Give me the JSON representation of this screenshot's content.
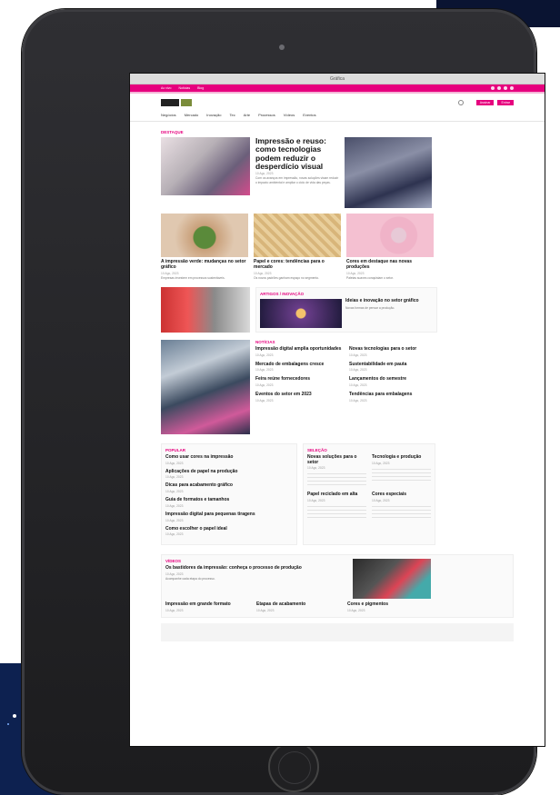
{
  "browser": {
    "title": "Gráfica"
  },
  "topbar": {
    "links": [
      "Ao vivo",
      "Notícias",
      "Blog"
    ]
  },
  "header": {
    "btn1": "Assinar",
    "btn2": "Entrar"
  },
  "nav": {
    "items": [
      "Negócios",
      "Mercado",
      "Inovação",
      "Tec",
      "Arte",
      "Processos",
      "Vídeos",
      "Eventos",
      "Embalagem"
    ]
  },
  "featured": {
    "label": "DESTAQUE",
    "title": "Impressão e reuso: como tecnologias podem reduzir o desperdício visual",
    "date": "10 Ago, 2023",
    "text": "Com os avanços em impressão, novas soluções visam reduzir o impacto ambiental e ampliar o ciclo de vida das peças."
  },
  "grid": [
    {
      "title": "A impressão verde: mudanças no setor gráfico",
      "date": "10 Ago, 2023",
      "text": "Empresas investem em processos sustentáveis."
    },
    {
      "title": "Papel e cores: tendências para o mercado",
      "date": "10 Ago, 2023",
      "text": "Os novos padrões ganham espaço no segmento."
    },
    {
      "title": "Cores em destaque nas novas produções",
      "date": "10 Ago, 2023",
      "text": "Paletas suaves conquistam o setor."
    }
  ],
  "inov": {
    "label": "ARTIGOS / INOVAÇÃO",
    "title": "Ideias e inovação no setor gráfico",
    "text": "Novas formas de pensar a produção."
  },
  "news": {
    "label": "NOTÍCIAS",
    "items": [
      {
        "t": "Impressão digital amplia oportunidades",
        "d": "10 Ago, 2023"
      },
      {
        "t": "Novas tecnologias para o setor",
        "d": "10 Ago, 2023"
      },
      {
        "t": "Mercado de embalagens cresce",
        "d": "10 Ago, 2023"
      },
      {
        "t": "Sustentabilidade em pauta",
        "d": "10 Ago, 2023"
      },
      {
        "t": "Feira reúne fornecedores",
        "d": "10 Ago, 2023"
      },
      {
        "t": "Lançamentos do semestre",
        "d": "10 Ago, 2023"
      },
      {
        "t": "Eventos do setor em 2023",
        "d": "10 Ago, 2023"
      },
      {
        "t": "Tendências para embalagens",
        "d": "10 Ago, 2023"
      }
    ]
  },
  "popular": {
    "label": "POPULAR",
    "items": [
      {
        "t": "Como usar cores na impressão",
        "d": "10 Ago, 2023"
      },
      {
        "t": "Aplicações de papel na produção",
        "d": "10 Ago, 2023"
      },
      {
        "t": "Dicas para acabamento gráfico",
        "d": "10 Ago, 2023"
      },
      {
        "t": "Guia de formatos e tamanhos",
        "d": "10 Ago, 2023"
      },
      {
        "t": "Impressão digital para pequenas tiragens",
        "d": "10 Ago, 2023"
      },
      {
        "t": "Como escolher o papel ideal",
        "d": "10 Ago, 2023"
      }
    ]
  },
  "selection": {
    "label": "SELEÇÃO",
    "items": [
      {
        "t": "Novas soluções para o setor",
        "d": "10 Ago, 2023"
      },
      {
        "t": "Tecnologia e produção",
        "d": "10 Ago, 2023"
      },
      {
        "t": "Papel reciclado em alta",
        "d": "10 Ago, 2023"
      },
      {
        "t": "Cores especiais",
        "d": "10 Ago, 2023"
      }
    ]
  },
  "video": {
    "label": "VÍDEOS",
    "title": "Os bastidores da impressão: conheça o processo de produção",
    "date": "10 Ago, 2023",
    "text": "Acompanhe cada etapa do processo.",
    "items": [
      {
        "t": "Impressão em grande formato",
        "d": "10 Ago, 2023"
      },
      {
        "t": "Etapas de acabamento",
        "d": "10 Ago, 2023"
      },
      {
        "t": "Cores e pigmentos",
        "d": "10 Ago, 2023"
      }
    ]
  }
}
